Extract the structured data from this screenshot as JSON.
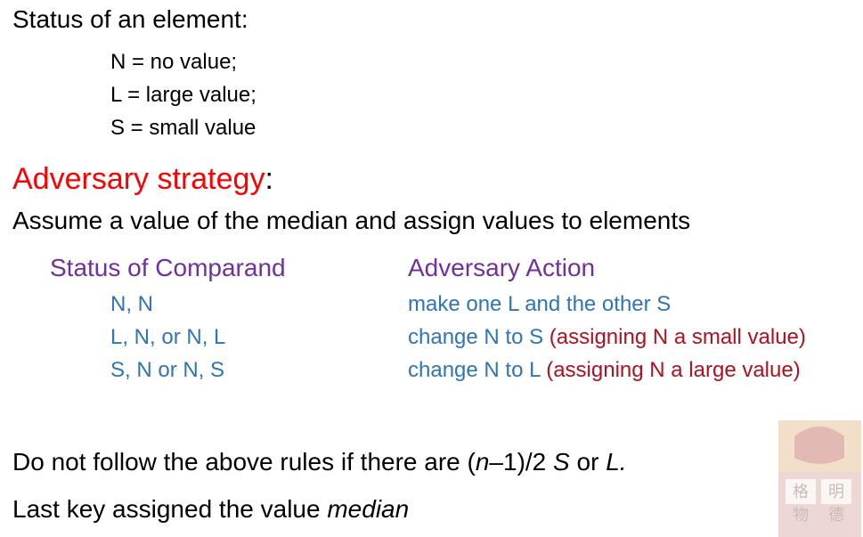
{
  "status": {
    "title": "Status of an element:",
    "lines": [
      "N = no value;",
      "L  = large value;",
      "S  = small value"
    ]
  },
  "adversary": {
    "heading": "Adversary strategy",
    "colon": ":",
    "assume": "Assume a value of the median and assign values to elements"
  },
  "table": {
    "headers": [
      "Status of Comparand",
      "Adversary Action"
    ],
    "rows": [
      {
        "status": "N, N",
        "action": "make one L and the other S",
        "note": ""
      },
      {
        "status": "L, N, or N, L",
        "action": "change N to S ",
        "note": "(assigning N a small value)"
      },
      {
        "status": "S, N or N, S",
        "action": "change N to L ",
        "note": "(assigning N a large value)"
      }
    ]
  },
  "rule": {
    "prefix": "Do not follow the above rules if there are  (",
    "n": "n",
    "expr": "–1)/2  ",
    "s": "S",
    "or": " or ",
    "l": "L."
  },
  "last": {
    "prefix": "Last key assigned the value ",
    "median": "median"
  },
  "colors": {
    "heading_red": "#ff0000",
    "purple": "#7030a0",
    "blue": "#2e75b6",
    "dark_red": "#b01020"
  },
  "watermark": {
    "chars": [
      "格",
      "明",
      "物",
      "德"
    ]
  }
}
